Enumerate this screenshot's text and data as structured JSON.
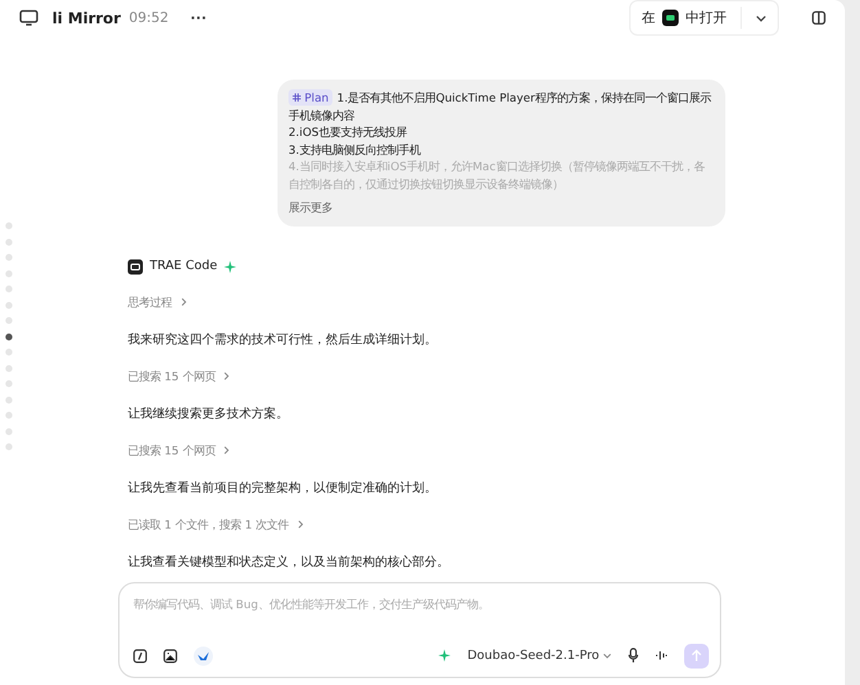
{
  "header": {
    "title": "li Mirror",
    "time": "09:52",
    "more": "···",
    "open_prefix": "在",
    "open_suffix": "中打开"
  },
  "user_message": {
    "badge": "Plan",
    "lines": [
      {
        "text": "1.是否有其他不启用QuickTime Player程序的方案，保持在同一个窗口展示手机镜像内容",
        "faded": false
      },
      {
        "text": "2.iOS也要支持无线投屏",
        "faded": false
      },
      {
        "text": "3.支持电脑侧反向控制手机",
        "faded": false
      },
      {
        "text": "4.当同时接入安卓和iOS手机时，允许Mac窗口选择切换（暂停镜像两端互不干扰，各自控制各自的，仅通过切换按钮切换显示设备终端镜像）",
        "faded": true
      }
    ],
    "show_more": "展示更多"
  },
  "agent": {
    "name": "TRAE Code",
    "items": [
      {
        "kind": "step",
        "text": "思考过程"
      },
      {
        "kind": "text",
        "text": "我来研究这四个需求的技术可行性，然后生成详细计划。"
      },
      {
        "kind": "step",
        "text": "已搜索 15 个网页"
      },
      {
        "kind": "text",
        "text": "让我继续搜索更多技术方案。"
      },
      {
        "kind": "step",
        "text": "已搜索 15 个网页"
      },
      {
        "kind": "text",
        "text": "让我先查看当前项目的完整架构，以便制定准确的计划。"
      },
      {
        "kind": "step",
        "text": "已读取 1 个文件，搜索 1 次文件"
      },
      {
        "kind": "text",
        "text": "让我查看关键模型和状态定义，以及当前架构的核心部分。"
      }
    ]
  },
  "nav_dots": [
    {
      "selected": false
    },
    {
      "selected": false
    },
    {
      "selected": false
    },
    {
      "selected": false
    },
    {
      "selected": false
    },
    {
      "selected": false
    },
    {
      "selected": false
    },
    {
      "selected": true
    },
    {
      "selected": false
    },
    {
      "selected": false
    },
    {
      "selected": false
    },
    {
      "selected": false
    },
    {
      "selected": false
    },
    {
      "selected": false
    },
    {
      "selected": false
    }
  ],
  "composer": {
    "placeholder": "帮你编写代码、调试 Bug、优化性能等开发工作，交付生产级代码产物。",
    "model": "Doubao-Seed-2.1-Pro"
  }
}
